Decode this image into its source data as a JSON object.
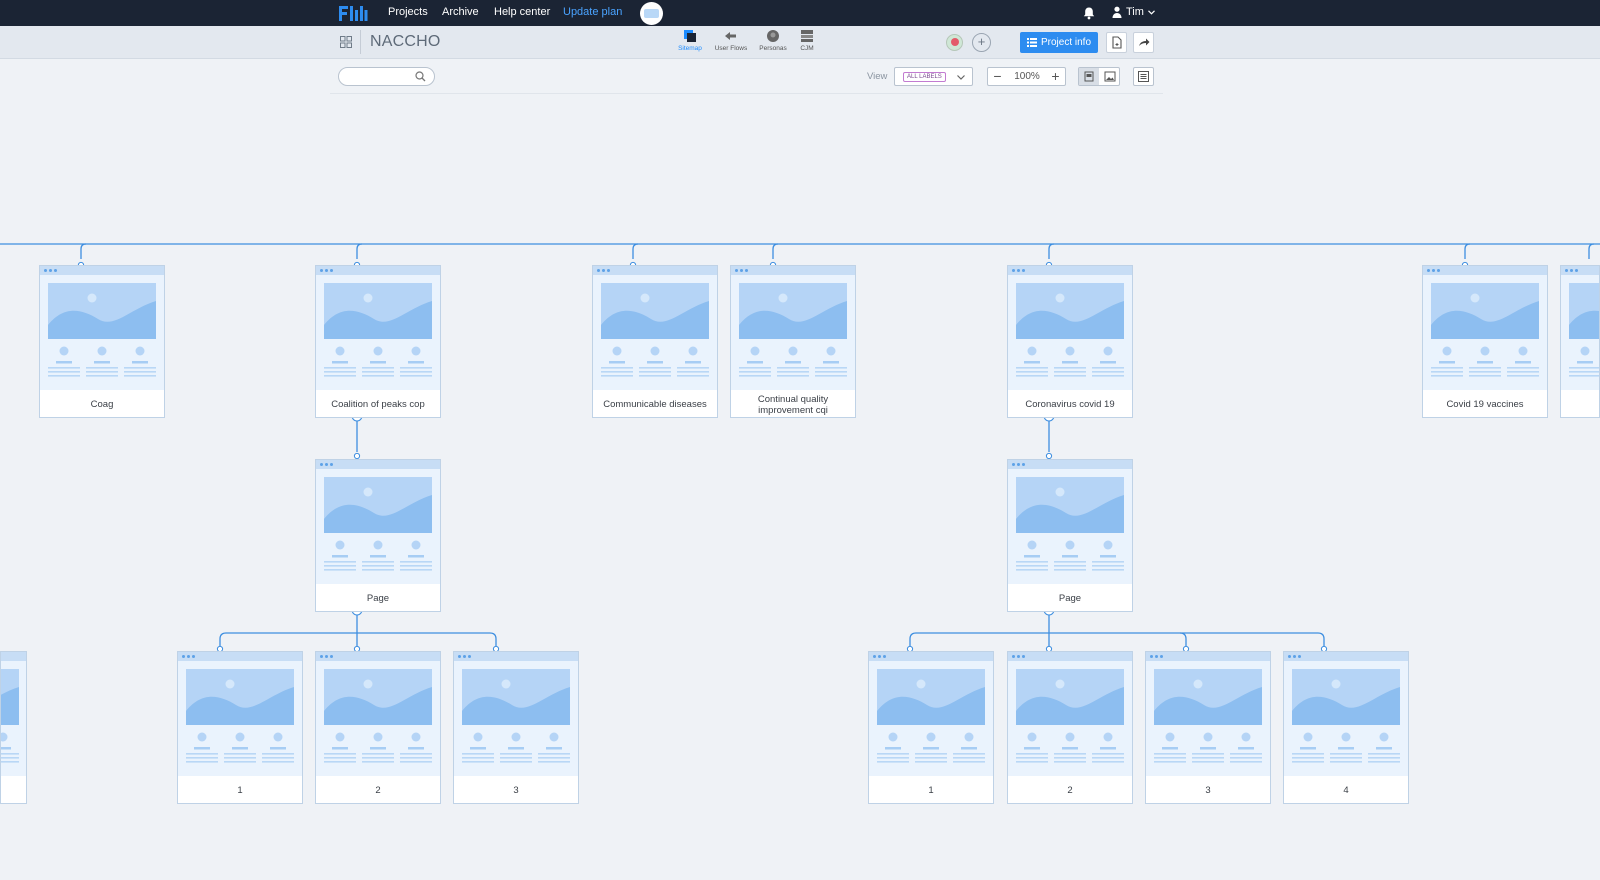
{
  "topbar": {
    "links": [
      "Projects",
      "Archive",
      "Help center"
    ],
    "update_plan": "Update plan",
    "user_name": "Tim"
  },
  "projectbar": {
    "title": "NACCHO",
    "view_tabs": [
      "Sitemap",
      "User Flows",
      "Personas",
      "CJM"
    ],
    "project_info_label": "Project info"
  },
  "filters": {
    "search_placeholder": "",
    "view_label": "View",
    "view_value": "ALL LABELS",
    "zoom": "100%"
  },
  "sitemap": {
    "top_pages": [
      "Coag",
      "Coalition of peaks cop",
      "Communicable diseases",
      "Continual quality improvement cqi",
      "Coronavirus covid 19",
      "Covid 19 vaccines"
    ],
    "second_level": [
      "Page",
      "Page"
    ],
    "peaks_children": [
      "1",
      "2",
      "3"
    ],
    "covid_children": [
      "1",
      "2",
      "3",
      "4"
    ]
  },
  "colors": {
    "accent": "#2d8cf0",
    "connector": "#3d8ee0",
    "topbar_bg": "#1b2434"
  }
}
